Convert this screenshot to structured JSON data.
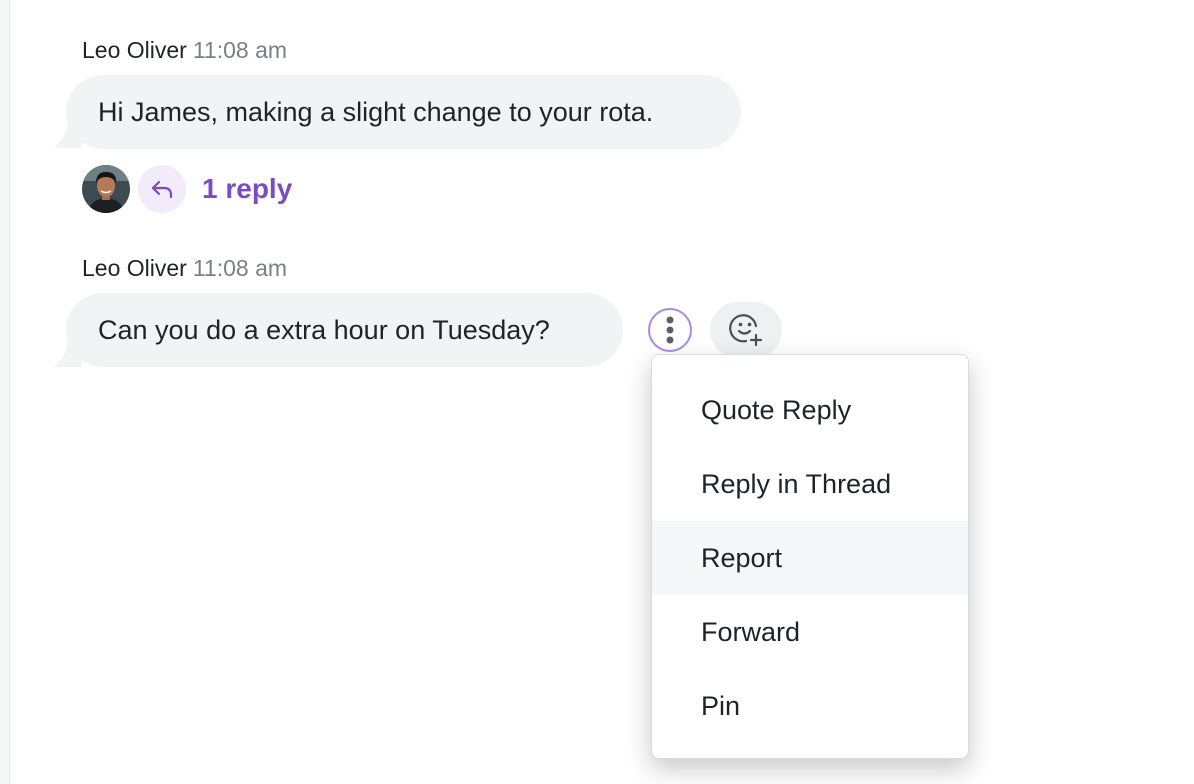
{
  "messages": [
    {
      "author": "Leo Oliver",
      "time": "11:08 am",
      "text": "Hi James, making a slight change to your rota.",
      "reply_count": "1 reply"
    },
    {
      "author": "Leo Oliver",
      "time": "11:08 am",
      "text": "Can you do a extra hour on Tuesday?"
    }
  ],
  "icons": {
    "reply": "reply-arrow-icon",
    "more": "vertical-dots-icon",
    "add_reaction": "emoji-add-icon"
  },
  "menu": {
    "items": [
      {
        "label": "Quote Reply"
      },
      {
        "label": "Reply in Thread"
      },
      {
        "label": "Report"
      },
      {
        "label": "Forward"
      },
      {
        "label": "Pin"
      }
    ],
    "highlighted": "Report"
  },
  "colors": {
    "accent": "#7c4bc4",
    "bubble": "#f2f3f5",
    "reply_bg": "#f1ebfb",
    "menu_hover": "#f6f7f9"
  }
}
